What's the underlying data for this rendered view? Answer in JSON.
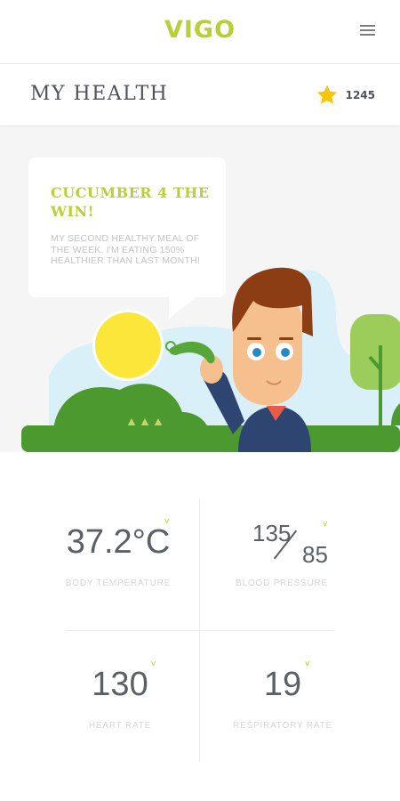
{
  "app": {
    "name": "VIGO",
    "brand_color": "#b9cf37"
  },
  "header": {
    "menu_icon": "hamburger-menu-icon"
  },
  "titlebar": {
    "title": "MY HEALTH",
    "points_icon": "star-icon",
    "points": "1245"
  },
  "hero": {
    "bubble_title": "CUCUMBER 4 THE WIN!",
    "bubble_text": "MY SECOND HEALTHY MEAL OF THE WEEK. I'M EATING 150% HEALTHIER THAN LAST MONTH!"
  },
  "stats": {
    "body_temperature": {
      "value": "37.2°C",
      "label": "BODY TEMPERATURE",
      "indicator": "v"
    },
    "blood_pressure": {
      "systolic": "135",
      "diastolic": "85",
      "label": "BLOOD PRESSURE",
      "indicator": "v"
    },
    "heart_rate": {
      "value": "130",
      "label": "HEART RATE",
      "indicator": "v"
    },
    "respiratory_rate": {
      "value": "19",
      "label": "RESPIRATORY RATE",
      "indicator": "v"
    }
  }
}
